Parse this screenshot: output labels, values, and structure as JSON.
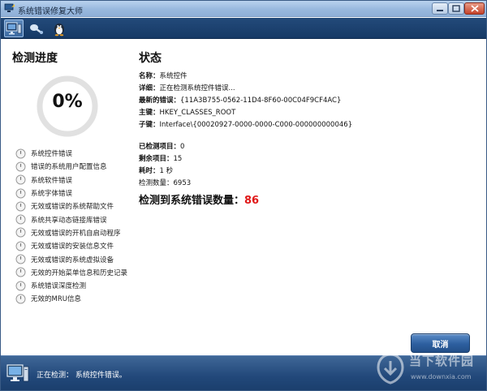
{
  "window": {
    "title": "系统错误修复大师",
    "icons": {
      "app": "app-logo-icon",
      "minimize": "minimize-icon",
      "maximize": "maximize-icon",
      "close": "close-icon"
    }
  },
  "toolbar": {
    "tools": [
      {
        "icon": "computer-scan-icon",
        "active": true
      },
      {
        "icon": "repair-tool-icon",
        "active": false
      },
      {
        "icon": "penguin-icon",
        "active": false
      }
    ]
  },
  "left_panel": {
    "title": "检测进度",
    "progress": {
      "value": 0,
      "display": "0%"
    },
    "checks": [
      "系统控件错误",
      "错误的系统用户配置信息",
      "系统软件错误",
      "系统字体错误",
      "无效或错误的系统帮助文件",
      "系统共享动态链接库错误",
      "无效或错误的开机自启动程序",
      "无效或错误的安装信息文件",
      "无效或错误的系统虚拟设备",
      "无效的开始菜单信息和历史记录",
      "系统错误深度检测",
      "无效的MRU信息"
    ]
  },
  "right_panel": {
    "title": "状态",
    "name_label": "名称：",
    "name_value": "系统控件",
    "detail_label": "详细：",
    "detail_value": "正在检测系统控件错误...",
    "latest_label": "最新的错误：",
    "latest_value": "{11A3B755-0562-11D4-8F60-00C04F9CF4AC}",
    "key_label": "主键：",
    "key_value": "HKEY_CLASSES_ROOT",
    "subkey_label": "子键：",
    "subkey_value": "Interface\\{00020927-0000-0000-C000-000000000046}",
    "checked_label": "已检测项目：",
    "checked_value": "0",
    "remaining_label": "剩余项目：",
    "remaining_value": "15",
    "elapsed_label": "耗时：",
    "elapsed_value": "1 秒",
    "count_label": "检测数量：",
    "count_value": "6953",
    "errors_label": "检测到系统错误数量：",
    "errors_value": "86"
  },
  "cancel_label": "取消",
  "status_bar": {
    "text": "正在检测： 系统控件错误。",
    "icon": "computer-icon"
  },
  "watermark": {
    "text": "当下软件园",
    "url": "www.downxia.com"
  },
  "colors": {
    "error_count": "#e01818",
    "toolbar_bg": "#1d4271",
    "status_bg": "#22487a"
  }
}
